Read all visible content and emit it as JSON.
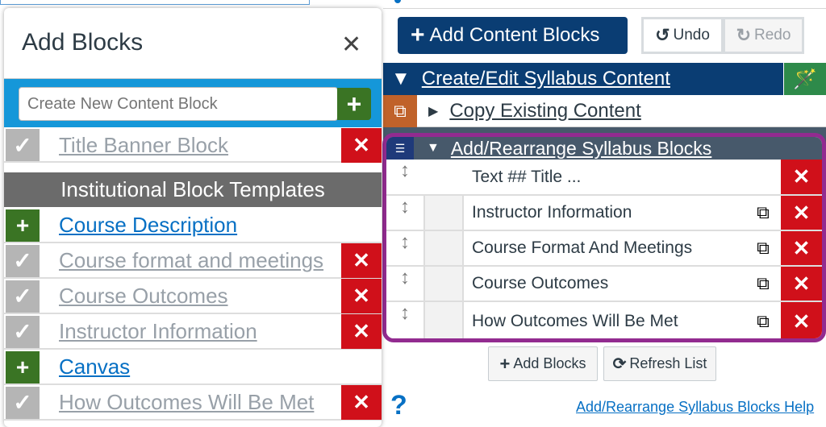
{
  "toolbar": {
    "add_content_blocks": "Add Content Blocks",
    "undo": "Undo",
    "redo": "Redo"
  },
  "sections": {
    "create_edit": "Create/Edit Syllabus Content",
    "copy_existing": "Copy Existing Content",
    "add_rearrange": "Add/Rearrange Syllabus Blocks"
  },
  "blocks": [
    {
      "label": "Text ## Title ...",
      "copyable": false
    },
    {
      "label": "Instructor Information",
      "copyable": true
    },
    {
      "label": "Course Format And Meetings",
      "copyable": true
    },
    {
      "label": "Course Outcomes",
      "copyable": true
    },
    {
      "label": "How Outcomes Will Be Met",
      "copyable": true
    }
  ],
  "actions": {
    "add_blocks": "Add Blocks",
    "refresh_list": "Refresh List",
    "help_link": "Add/Rearrange Syllabus Blocks Help"
  },
  "modal": {
    "title": "Add Blocks",
    "input_placeholder": "Create New Content Block",
    "title_banner": "Title Banner Block",
    "group_header": "Institutional Block Templates",
    "items": [
      {
        "label": "Course Description",
        "state": "available"
      },
      {
        "label": "Course format and meetings",
        "state": "added"
      },
      {
        "label": "Course Outcomes",
        "state": "added"
      },
      {
        "label": "Instructor Information",
        "state": "added"
      },
      {
        "label": "Canvas",
        "state": "available"
      },
      {
        "label": "How Outcomes Will Be Met",
        "state": "added"
      }
    ]
  },
  "colors": {
    "primary": "#0a3d73",
    "highlight": "#922b90",
    "danger": "#d0101a",
    "success": "#3a7424",
    "link": "#0770c4"
  }
}
